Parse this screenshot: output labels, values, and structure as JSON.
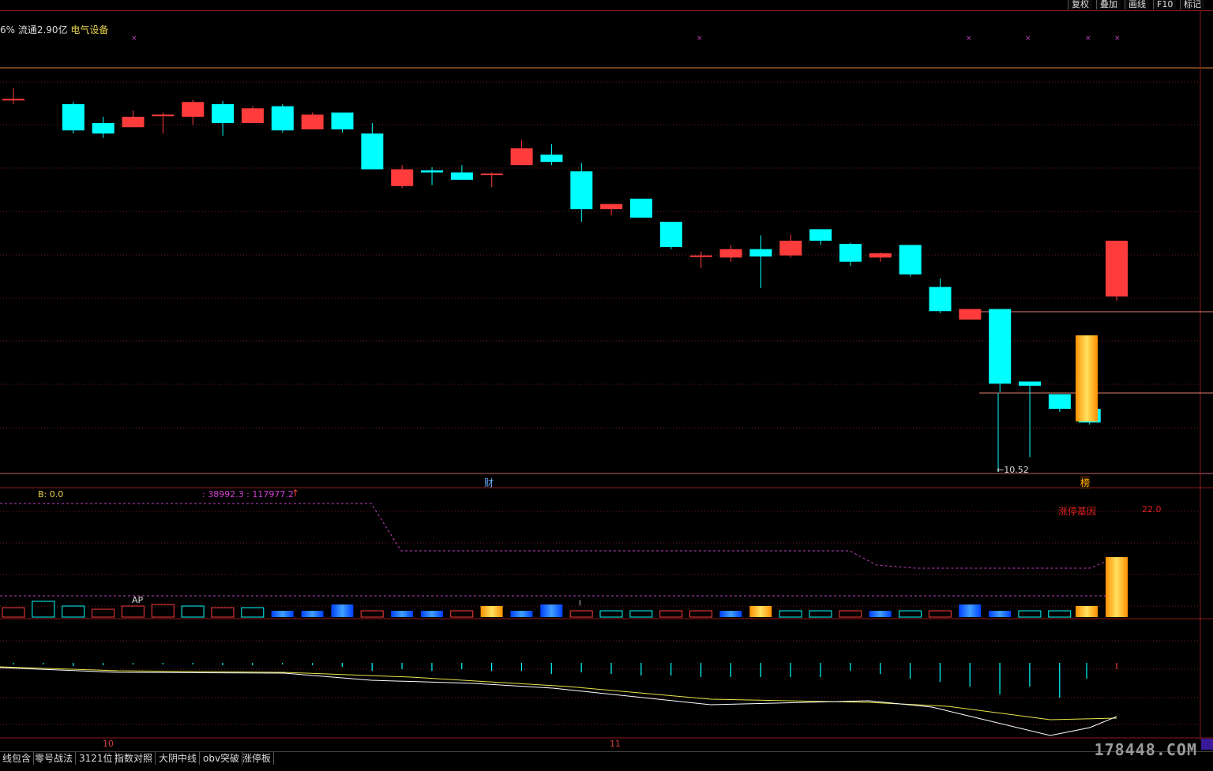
{
  "toolbar": {
    "buttons": [
      "复权",
      "叠加",
      "画线",
      "F10",
      "标记"
    ]
  },
  "info": {
    "prefix": "6% 流通2.90亿",
    "industry": "电气设备"
  },
  "markers": {
    "finance": "财",
    "board": "榜"
  },
  "price_low_label": "←10.52",
  "vol_panel": {
    "b_label": "B: 0.0",
    "values_label": ": 38992.3 : 117977.2",
    "arrow": "↑",
    "gene_label": "涨停基因",
    "gene_value": "22.0",
    "ap_label": "AP",
    "tick_label": "I"
  },
  "x_axis": {
    "month1": "10",
    "month2": "11"
  },
  "tabs": [
    "线包含",
    "零号战法",
    "3121位",
    "指数对照",
    "大阴中线",
    "obv突破",
    "涨停板"
  ],
  "watermark": "178448.COM",
  "colors": {
    "up": "#ff3c3c",
    "down": "#00ffff",
    "limit_up_gold": "#ffb000",
    "grid": "#7a1e1e",
    "magenta": "#c040c0"
  },
  "chart_data": {
    "type": "candlestick",
    "candles": [
      {
        "o": 11.95,
        "c": 11.95,
        "h": 12.05,
        "l": 11.9,
        "kind": "up"
      },
      {
        "o": 11.9,
        "c": 11.65,
        "h": 11.92,
        "l": 11.62,
        "kind": "down"
      },
      {
        "o": 11.72,
        "c": 11.62,
        "h": 11.78,
        "l": 11.58,
        "kind": "down"
      },
      {
        "o": 11.68,
        "c": 11.78,
        "h": 11.84,
        "l": 11.68,
        "kind": "up"
      },
      {
        "o": 11.8,
        "c": 11.8,
        "h": 11.82,
        "l": 11.62,
        "kind": "up"
      },
      {
        "o": 11.78,
        "c": 11.92,
        "h": 11.94,
        "l": 11.7,
        "kind": "up"
      },
      {
        "o": 11.9,
        "c": 11.72,
        "h": 11.93,
        "l": 11.6,
        "kind": "down"
      },
      {
        "o": 11.72,
        "c": 11.86,
        "h": 11.88,
        "l": 11.72,
        "kind": "up"
      },
      {
        "o": 11.88,
        "c": 11.65,
        "h": 11.9,
        "l": 11.63,
        "kind": "down"
      },
      {
        "o": 11.66,
        "c": 11.8,
        "h": 11.82,
        "l": 11.66,
        "kind": "up"
      },
      {
        "o": 11.82,
        "c": 11.66,
        "h": 11.82,
        "l": 11.63,
        "kind": "down"
      },
      {
        "o": 11.62,
        "c": 11.28,
        "h": 11.72,
        "l": 11.28,
        "kind": "down"
      },
      {
        "o": 11.12,
        "c": 11.28,
        "h": 11.32,
        "l": 11.1,
        "kind": "up"
      },
      {
        "o": 11.27,
        "c": 11.25,
        "h": 11.3,
        "l": 11.13,
        "kind": "down"
      },
      {
        "o": 11.25,
        "c": 11.18,
        "h": 11.32,
        "l": 11.18,
        "kind": "down"
      },
      {
        "o": 11.24,
        "c": 11.24,
        "h": 11.25,
        "l": 11.11,
        "kind": "up"
      },
      {
        "o": 11.32,
        "c": 11.48,
        "h": 11.56,
        "l": 11.32,
        "kind": "up"
      },
      {
        "o": 11.42,
        "c": 11.35,
        "h": 11.52,
        "l": 11.32,
        "kind": "down"
      },
      {
        "o": 11.26,
        "c": 10.9,
        "h": 11.34,
        "l": 10.78,
        "kind": "down"
      },
      {
        "o": 10.9,
        "c": 10.95,
        "h": 10.95,
        "l": 10.84,
        "kind": "up"
      },
      {
        "o": 11.0,
        "c": 10.82,
        "h": 11.0,
        "l": 10.82,
        "kind": "down"
      },
      {
        "o": 10.78,
        "c": 10.54,
        "h": 10.78,
        "l": 10.52,
        "kind": "down"
      },
      {
        "o": 10.46,
        "c": 10.46,
        "h": 10.5,
        "l": 10.34,
        "kind": "up"
      },
      {
        "o": 10.44,
        "c": 10.52,
        "h": 10.56,
        "l": 10.4,
        "kind": "up"
      },
      {
        "o": 10.52,
        "c": 10.45,
        "h": 10.65,
        "l": 10.15,
        "kind": "down"
      },
      {
        "o": 10.46,
        "c": 10.6,
        "h": 10.66,
        "l": 10.44,
        "kind": "up"
      },
      {
        "o": 10.71,
        "c": 10.6,
        "h": 10.71,
        "l": 10.56,
        "kind": "down"
      },
      {
        "o": 10.57,
        "c": 10.4,
        "h": 10.58,
        "l": 10.36,
        "kind": "down"
      },
      {
        "o": 10.44,
        "c": 10.48,
        "h": 10.49,
        "l": 10.4,
        "kind": "up"
      },
      {
        "o": 10.56,
        "c": 10.28,
        "h": 10.56,
        "l": 10.26,
        "kind": "down"
      },
      {
        "o": 10.16,
        "c": 9.93,
        "h": 10.24,
        "l": 9.91,
        "kind": "down"
      },
      {
        "o": 9.85,
        "c": 9.95,
        "h": 9.95,
        "l": 9.85,
        "kind": "up"
      },
      {
        "o": 9.95,
        "c": 9.24,
        "h": 9.95,
        "l": 9.16,
        "kind": "down"
      },
      {
        "o": 9.26,
        "c": 9.22,
        "h": 9.26,
        "l": 8.54,
        "kind": "down"
      },
      {
        "o": 9.14,
        "c": 9.0,
        "h": 9.14,
        "l": 8.97,
        "kind": "down"
      },
      {
        "o": 9.0,
        "c": 8.87,
        "h": 9.03,
        "l": 8.85,
        "kind": "down"
      },
      {
        "o": 8.88,
        "c": 9.7,
        "h": 9.7,
        "l": 8.88,
        "kind": "limit"
      },
      {
        "o": 10.07,
        "c": 10.6,
        "h": 10.6,
        "l": 10.03,
        "kind": "up"
      }
    ],
    "low_price": 10.52
  }
}
